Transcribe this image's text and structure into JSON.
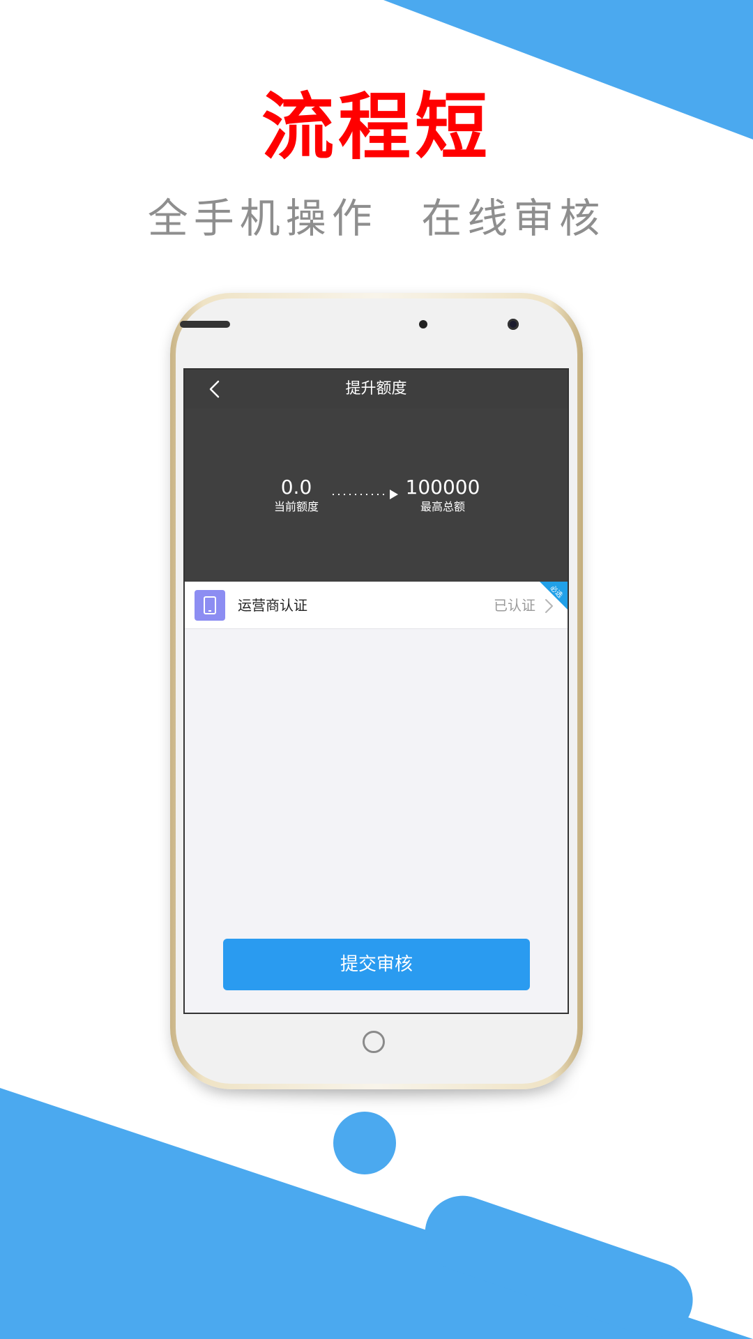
{
  "headline": "流程短",
  "subline": [
    "全手机操作",
    "在线审核"
  ],
  "screen": {
    "nav_title": "提升额度",
    "current_value": "0.0",
    "current_label": "当前额度",
    "max_value": "100000",
    "max_label": "最高总额",
    "row": {
      "icon": "phone-icon",
      "label": "运营商认证",
      "status": "已认证",
      "tag": "必选"
    },
    "submit_label": "提交审核"
  },
  "colors": {
    "accent_blue": "#4ba9ef",
    "headline_red": "#ff0000",
    "button_blue": "#2a9bf0",
    "dark_header": "#404040",
    "icon_purple": "#8c8df2"
  }
}
